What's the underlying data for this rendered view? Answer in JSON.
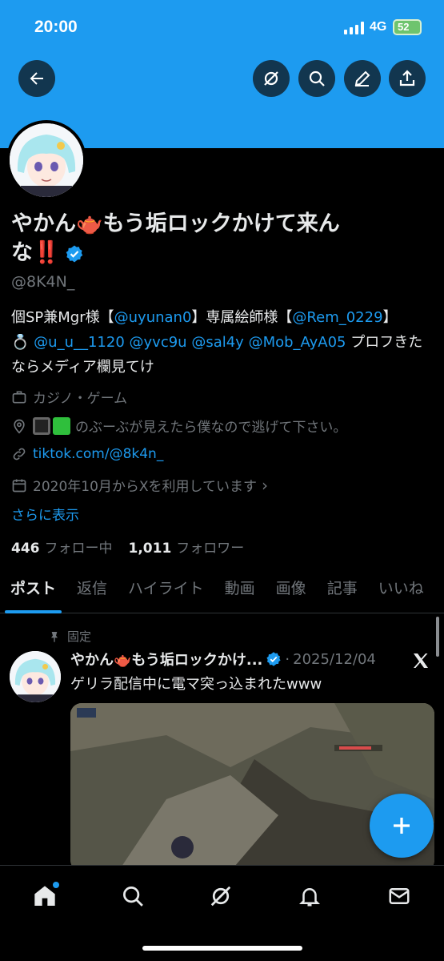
{
  "status_bar": {
    "time": "20:00",
    "network": "4G",
    "battery": "52"
  },
  "profile": {
    "display_name": "やかん🫖もう垢ロックかけて来んな‼️",
    "handle": "@8K4N_",
    "bio_prefix": "個SP兼Mgr様【",
    "bio_mention_1": "@uyunan0",
    "bio_mid_1": "】専属絵師様【",
    "bio_mention_2": "@Rem_0229",
    "bio_mid_2": "】",
    "bio_ring": "💍",
    "bio_mention_3": "@u_u__1120",
    "bio_mention_4": "@yvc9u",
    "bio_mention_5": "@sal4y",
    "bio_mention_6": "@Mob_AyA05",
    "bio_suffix": "プロフきたならメディア欄見てけ",
    "category": "カジノ・ゲーム",
    "location_text": "のぶーぶが見えたら僕なので逃げて下さい。",
    "website": "tiktok.com/@8k4n_",
    "joined": "2020年10月からXを利用しています",
    "joined_chevron": "›",
    "show_more": "さらに表示",
    "following_count": "446",
    "following_label": "フォロー中",
    "followers_count": "1,011",
    "followers_label": "フォロワー"
  },
  "tabs": [
    {
      "label": "ポスト"
    },
    {
      "label": "返信"
    },
    {
      "label": "ハイライト"
    },
    {
      "label": "動画"
    },
    {
      "label": "画像"
    },
    {
      "label": "記事"
    },
    {
      "label": "いいね"
    }
  ],
  "pinned_post": {
    "pinned_label": "固定",
    "author_name": "やかん🫖もう垢ロックかけ...",
    "separator": "·",
    "date": "2025/12/04",
    "text": "ゲリラ配信中に電マ突っ込まれたwww"
  },
  "colors": {
    "accent": "#1d9bf0",
    "background": "#000000",
    "muted": "#71767b"
  },
  "icons": [
    "back-arrow-icon",
    "grok-icon",
    "search-icon",
    "edit-icon",
    "share-icon",
    "verified-badge-icon",
    "briefcase-icon",
    "location-pin-icon",
    "link-icon",
    "calendar-icon",
    "pin-icon",
    "x-logo-icon",
    "plus-icon",
    "home-icon",
    "bell-icon",
    "mail-icon"
  ]
}
